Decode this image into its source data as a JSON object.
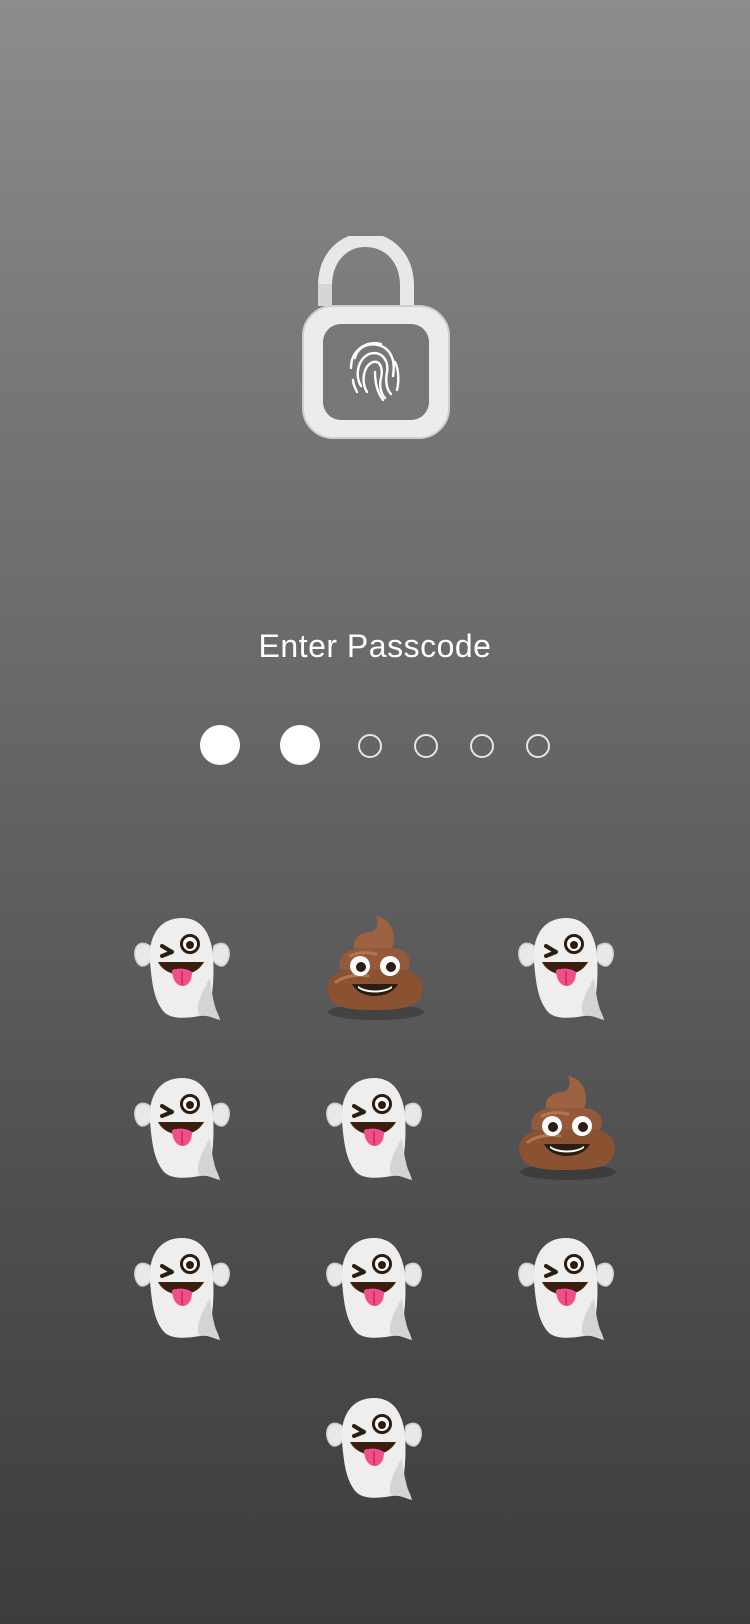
{
  "lock_icon": "unlocked-padlock-with-fingerprint-icon",
  "title": "Enter Passcode",
  "passcode": {
    "length": 6,
    "entered": 2
  },
  "keypad": {
    "keys": [
      "ghost-emoji",
      "poop-emoji",
      "ghost-emoji",
      "ghost-emoji",
      "ghost-emoji",
      "poop-emoji",
      "ghost-emoji",
      "ghost-emoji",
      "ghost-emoji",
      "ghost-emoji"
    ]
  },
  "colors": {
    "background_top": "#8c8c8c",
    "background_bottom": "#3d3d3d",
    "text": "#ffffff"
  }
}
